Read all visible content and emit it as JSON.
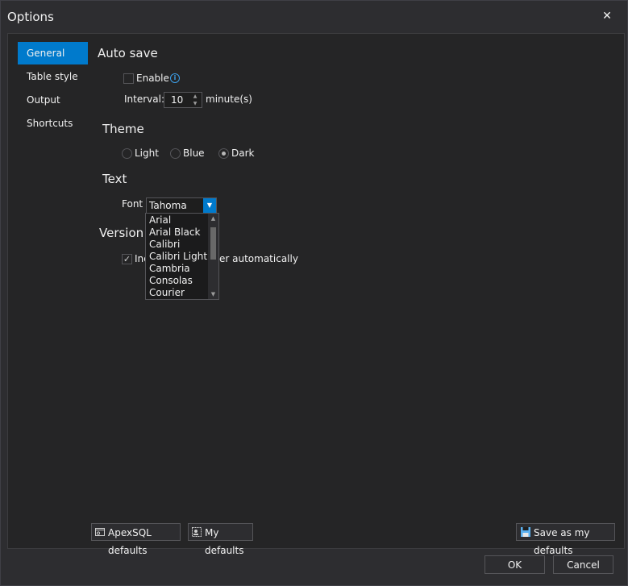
{
  "window": {
    "title": "Options"
  },
  "sidebar": {
    "items": [
      {
        "label": "General",
        "active": true
      },
      {
        "label": "Table style",
        "active": false
      },
      {
        "label": "Output",
        "active": false
      },
      {
        "label": "Shortcuts",
        "active": false
      }
    ]
  },
  "auto_save": {
    "title": "Auto save",
    "enable_label": "Enable",
    "enable_checked": false,
    "interval_label": "Interval:",
    "interval_value": "10",
    "interval_unit": "minute(s)"
  },
  "theme": {
    "title": "Theme",
    "options": [
      {
        "label": "Light",
        "selected": false
      },
      {
        "label": "Blue",
        "selected": false
      },
      {
        "label": "Dark",
        "selected": true
      }
    ]
  },
  "text": {
    "title": "Text",
    "font_label": "Font",
    "font_value": "Tahoma",
    "font_options_visible": [
      "Arial",
      "Arial Black",
      "Calibri",
      "Calibri Light",
      "Cambria",
      "Consolas",
      "Courier"
    ]
  },
  "version": {
    "title_visible": "Version n",
    "checkbox_label_start": "Inc",
    "checkbox_label_end": "er automatically",
    "checked": true
  },
  "footer": {
    "apexsql_defaults_label": "ApexSQL defaults",
    "my_defaults_label": "My defaults",
    "save_as_my_defaults_label": "Save as my defaults",
    "ok_label": "OK",
    "cancel_label": "Cancel"
  },
  "colors": {
    "accent": "#007acc",
    "background": "#2d2d30",
    "panel": "#252526"
  }
}
